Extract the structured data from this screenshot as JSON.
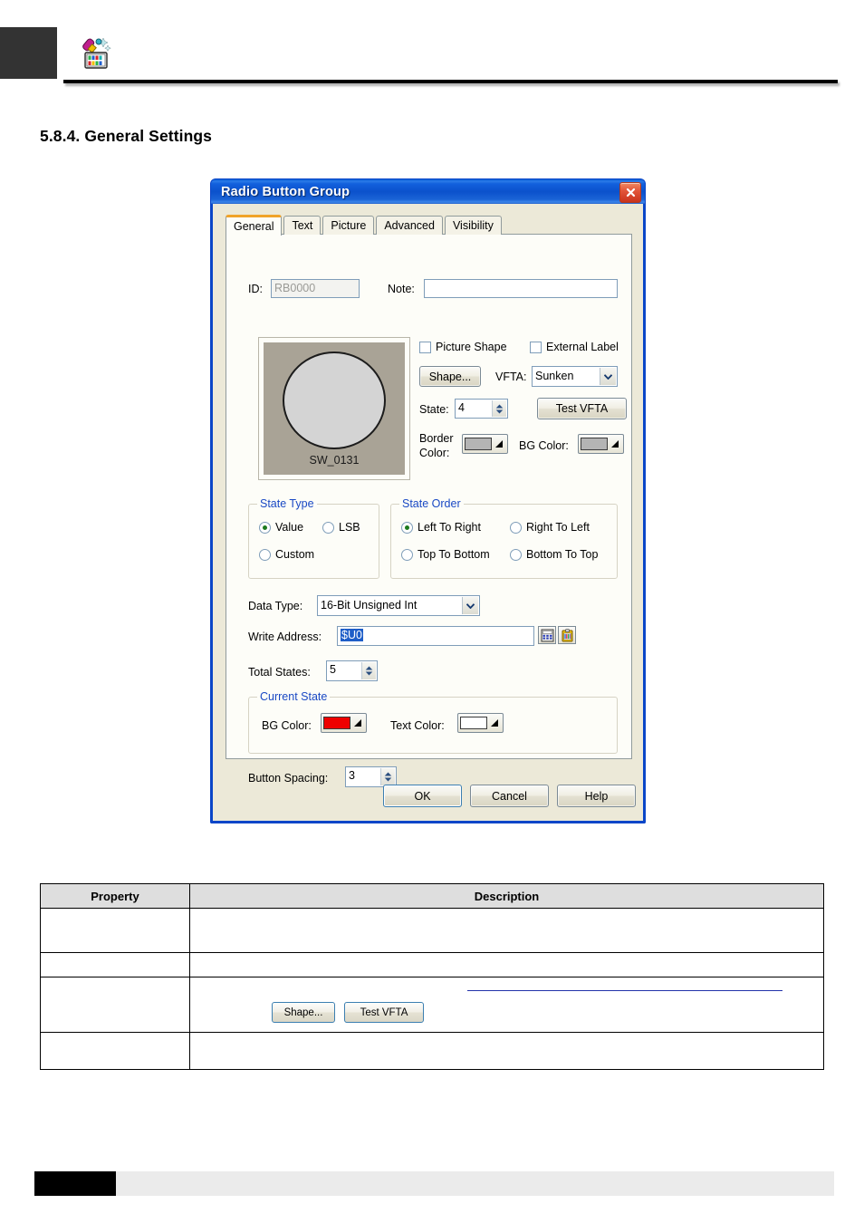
{
  "page": {
    "section_title": "5.8.4. General Settings",
    "header_icon": "design-tool-icon"
  },
  "dialog": {
    "title": "Radio Button Group",
    "close_label": "×",
    "tabs": [
      {
        "label": "General",
        "active": true
      },
      {
        "label": "Text",
        "active": false
      },
      {
        "label": "Picture",
        "active": false
      },
      {
        "label": "Advanced",
        "active": false
      },
      {
        "label": "Visibility",
        "active": false
      }
    ],
    "id_label": "ID:",
    "id_value": "RB0000",
    "note_label": "Note:",
    "note_value": "",
    "preview": {
      "shape_label": "SW_0131",
      "bg_color": "#a9a396",
      "shape_fill": "#d4d4d4",
      "shape_border": "#1c1c1c"
    },
    "picture_shape_label": "Picture Shape",
    "picture_shape_checked": false,
    "external_label_label": "External Label",
    "external_label_checked": false,
    "shape_button": "Shape...",
    "vfta_label": "VFTA:",
    "vfta_value": "Sunken",
    "vfta_options": [
      "Sunken"
    ],
    "state_label": "State:",
    "state_value": "4",
    "test_vfta_button": "Test VFTA",
    "border_color_label_1": "Border",
    "border_color_label_2": "Color:",
    "border_color_value": "#b4b4b4",
    "bg_color_label": "BG Color:",
    "bg_color_value": "#b4b4b4",
    "state_type": {
      "title": "State Type",
      "options": [
        {
          "label": "Value",
          "selected": true
        },
        {
          "label": "LSB",
          "selected": false
        },
        {
          "label": "Custom",
          "selected": false
        }
      ]
    },
    "state_order": {
      "title": "State Order",
      "options": [
        {
          "label": "Left To Right",
          "selected": true
        },
        {
          "label": "Right To Left",
          "selected": false
        },
        {
          "label": "Top To Bottom",
          "selected": false
        },
        {
          "label": "Bottom To Top",
          "selected": false
        }
      ]
    },
    "data_type_label": "Data Type:",
    "data_type_value": "16-Bit Unsigned Int",
    "data_type_options": [
      "16-Bit Unsigned Int"
    ],
    "write_address_label": "Write Address:",
    "write_address_value": "$U0",
    "write_address_icons": [
      "keypad-icon",
      "tag-icon"
    ],
    "total_states_label": "Total States:",
    "total_states_value": "5",
    "current_state": {
      "title": "Current State",
      "bg_color_label": "BG Color:",
      "bg_color_value": "#ee0000",
      "text_color_label": "Text Color:",
      "text_color_value": "#ffffff"
    },
    "button_spacing_label": "Button Spacing:",
    "button_spacing_value": "3",
    "ok_button": "OK",
    "cancel_button": "Cancel",
    "help_button": "Help"
  },
  "table": {
    "headers": [
      "Property",
      "Description"
    ],
    "rows": [
      {
        "property": "",
        "description": ""
      },
      {
        "property": "",
        "description": ""
      },
      {
        "property": "",
        "description": ""
      },
      {
        "property": "",
        "description": ""
      }
    ],
    "inline_buttons": [
      "Shape...",
      "Test VFTA"
    ]
  }
}
